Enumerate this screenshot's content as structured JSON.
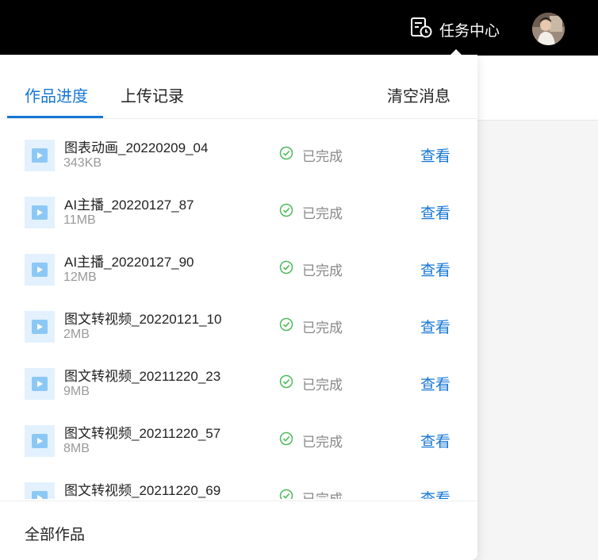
{
  "header": {
    "task_center_label": "任务中心"
  },
  "panel": {
    "tabs": [
      {
        "label": "作品进度",
        "active": true
      },
      {
        "label": "上传记录",
        "active": false
      }
    ],
    "clear_label": "清空消息",
    "items": [
      {
        "name": "图表动画_20220209_04",
        "size": "343KB",
        "status": "已完成",
        "action": "查看"
      },
      {
        "name": "AI主播_20220127_87",
        "size": "11MB",
        "status": "已完成",
        "action": "查看"
      },
      {
        "name": "AI主播_20220127_90",
        "size": "12MB",
        "status": "已完成",
        "action": "查看"
      },
      {
        "name": "图文转视频_20220121_10",
        "size": "2MB",
        "status": "已完成",
        "action": "查看"
      },
      {
        "name": "图文转视频_20211220_23",
        "size": "9MB",
        "status": "已完成",
        "action": "查看"
      },
      {
        "name": "图文转视频_20211220_57",
        "size": "8MB",
        "status": "已完成",
        "action": "查看"
      },
      {
        "name": "图文转视频_20211220_69",
        "size": "",
        "status": "已完成",
        "action": "查看"
      }
    ],
    "footer_label": "全部作品"
  },
  "colors": {
    "accent": "#1677d6",
    "success": "#4cbb5a",
    "topbar": "#000000"
  }
}
